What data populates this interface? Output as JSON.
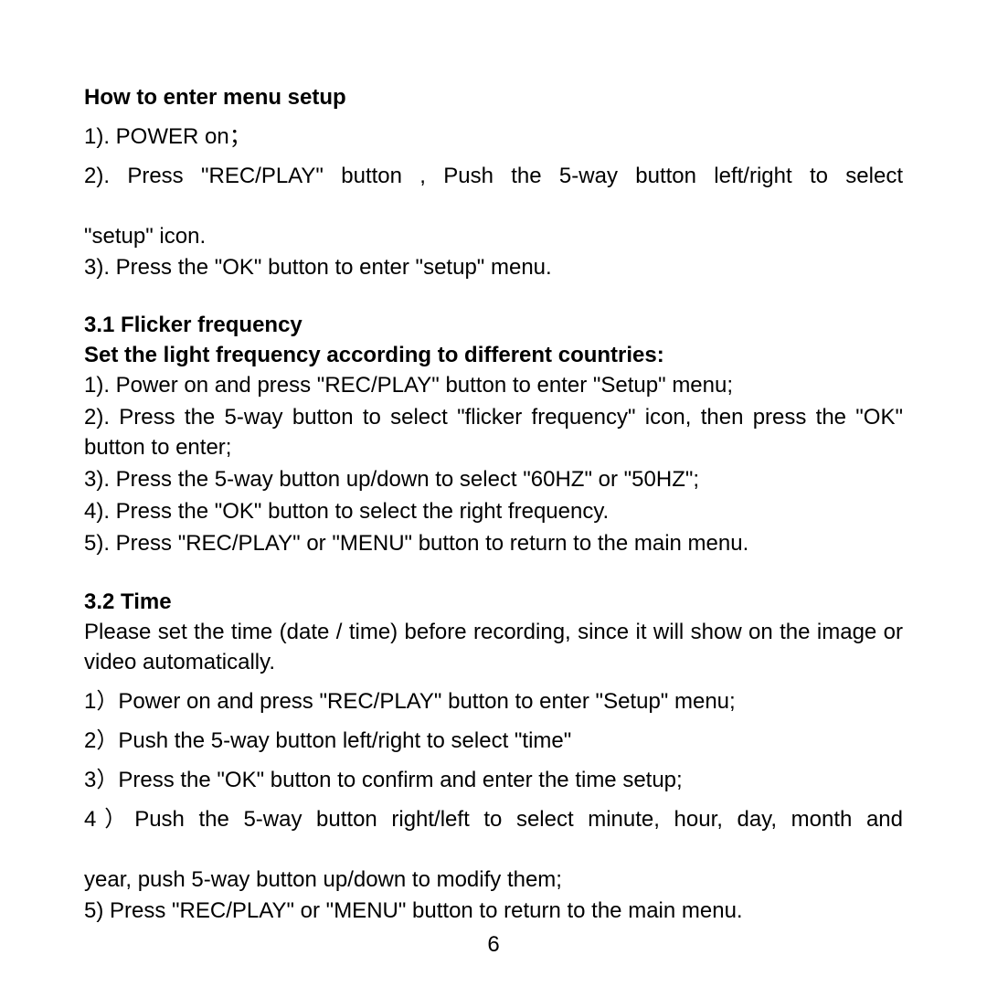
{
  "section1": {
    "heading": "How to enter menu setup",
    "step1": "1). POWER on；",
    "step2_line1": "2). Press \"REC/PLAY\" button , Push the 5-way button left/right to select",
    "step2_line2": "\"setup\" icon.",
    "step3": "3). Press the \"OK\" button to enter \"setup\" menu."
  },
  "section2": {
    "heading": "3.1  Flicker frequency",
    "subheading": "Set the light frequency according to different countries:",
    "step1": "1). Power on and press \"REC/PLAY\" button to enter \"Setup\" menu;",
    "step2": "2). Press the 5-way button to select \"flicker frequency\" icon, then press the \"OK\" button to enter;",
    "step3": "3). Press the 5-way button up/down to select \"60HZ\" or \"50HZ\";",
    "step4": "4). Press the \"OK\" button to select the right frequency.",
    "step5": "5). Press \"REC/PLAY\" or \"MENU\" button to return to the main menu."
  },
  "section3": {
    "heading": "3.2  Time",
    "intro": "Please set the time (date / time) before recording, since it will show on the image or video automatically.",
    "step1": "1）Power on and press \"REC/PLAY\" button to enter \"Setup\" menu;",
    "step2": "2）Push the 5-way button left/right to select \"time\"",
    "step3": "3）Press the \"OK\" button to confirm and enter the time setup;",
    "step4_line1": "4）Push the 5-way button right/left to select minute, hour, day, month and",
    "step4_line2": " year, push 5-way button up/down to modify them;",
    "step5": "5) Press \"REC/PLAY\" or \"MENU\" button to return to the main menu."
  },
  "page_number": "6"
}
